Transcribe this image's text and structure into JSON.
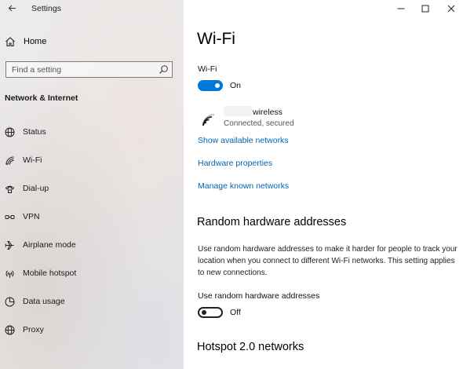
{
  "window": {
    "title": "Settings"
  },
  "sidebar": {
    "home_label": "Home",
    "search_placeholder": "Find a setting",
    "section_header": "Network & Internet",
    "items": [
      {
        "label": "Status",
        "icon": "globe-icon"
      },
      {
        "label": "Wi-Fi",
        "icon": "wifi-icon"
      },
      {
        "label": "Dial-up",
        "icon": "phone-icon"
      },
      {
        "label": "VPN",
        "icon": "vpn-icon"
      },
      {
        "label": "Airplane mode",
        "icon": "airplane-icon"
      },
      {
        "label": "Mobile hotspot",
        "icon": "hotspot-icon"
      },
      {
        "label": "Data usage",
        "icon": "pie-chart-icon"
      },
      {
        "label": "Proxy",
        "icon": "globe-icon"
      }
    ]
  },
  "main": {
    "title": "Wi-Fi",
    "wifi_toggle": {
      "label": "Wi-Fi",
      "state": "On",
      "on": true
    },
    "network": {
      "name": "wireless",
      "status": "Connected, secured"
    },
    "links": {
      "show_available": "Show available networks",
      "hardware_properties": "Hardware properties",
      "manage_known": "Manage known networks"
    },
    "random_hw": {
      "heading": "Random hardware addresses",
      "description": "Use random hardware addresses to make it harder for people to track your location when you connect to different Wi-Fi networks. This setting applies to new connections.",
      "toggle_label": "Use random hardware addresses",
      "state": "Off",
      "on": false
    },
    "hotspot_heading": "Hotspot 2.0 networks"
  },
  "colors": {
    "accent": "#0078d7",
    "link": "#0063b1"
  }
}
